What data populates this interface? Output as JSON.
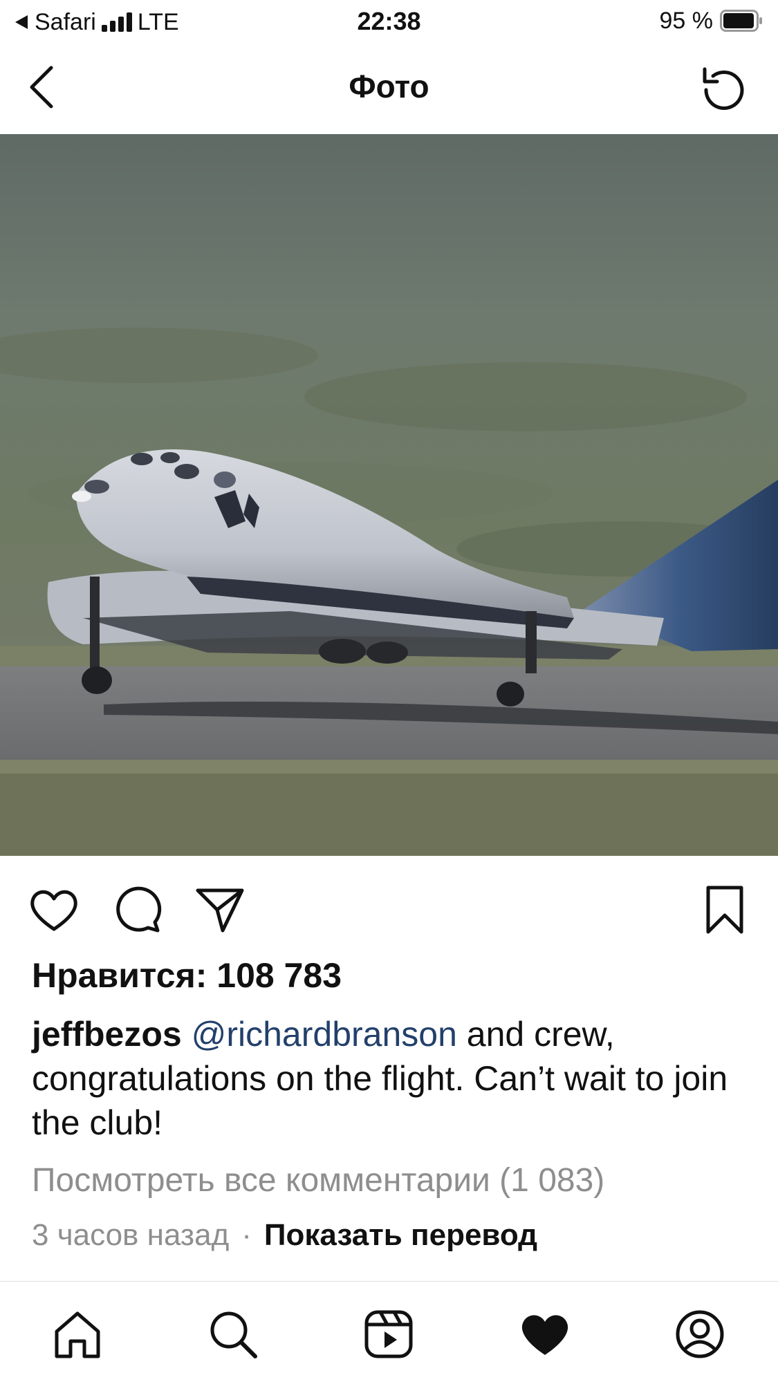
{
  "status": {
    "carrier": "Safari",
    "network": "LTE",
    "time": "22:38",
    "battery": "95 %"
  },
  "header": {
    "title": "Фото",
    "back_icon": "chevron-left-icon",
    "refresh_icon": "refresh-icon"
  },
  "post": {
    "likes": "Нравится: 108 783",
    "username": "jeffbezos",
    "mention": "@richardbranson",
    "caption_rest": " and crew, congratulations on the flight. Can’t wait to join the club!",
    "view_comments": "Посмотреть все комментарии (1 083)",
    "time_ago": "3 часов назад",
    "separator": "·",
    "translate": "Показать перевод"
  },
  "actions": [
    "heart-icon",
    "comment-icon",
    "share-icon",
    "bookmark-icon"
  ],
  "tabs": [
    "home-icon",
    "search-icon",
    "reels-icon",
    "activity-heart-icon",
    "profile-icon"
  ],
  "colors": {
    "mention": "#23406b",
    "muted": "#8e8e8e"
  }
}
